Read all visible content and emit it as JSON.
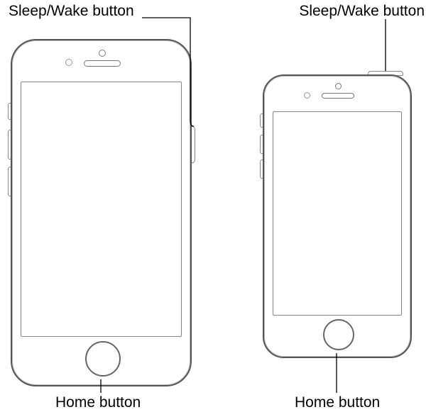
{
  "labels": {
    "phone1": {
      "sleep_wake": "Sleep/Wake button",
      "home": "Home button"
    },
    "phone2": {
      "sleep_wake": "Sleep/Wake button",
      "home": "Home button"
    }
  }
}
